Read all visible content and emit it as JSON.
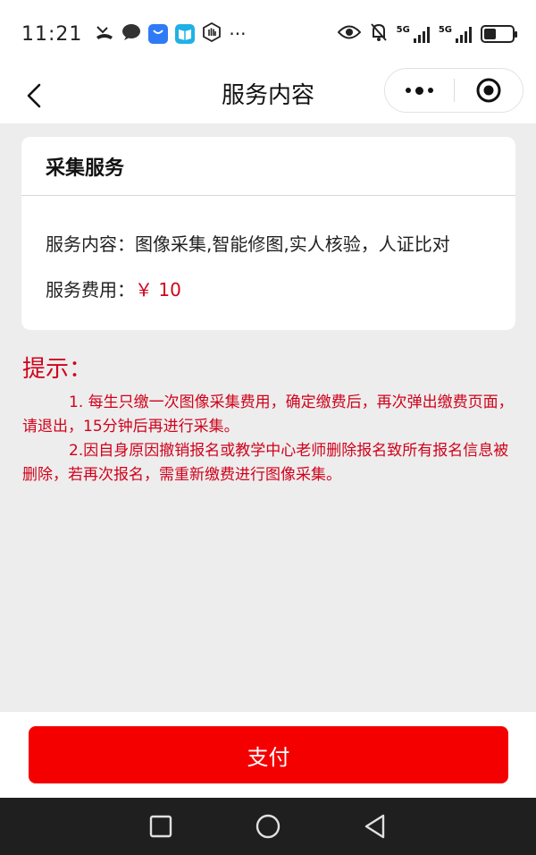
{
  "status_bar": {
    "time": "11:21",
    "more_dots": "···",
    "network_1": "5G",
    "network_2": "5G",
    "battery_level": 0.45
  },
  "nav": {
    "title": "服务内容"
  },
  "card": {
    "title": "采集服务",
    "content_label": "服务内容：",
    "content_value": "图像采集,智能修图,实人核验，人证比对",
    "fee_label": "服务费用：",
    "fee_value": "￥ 10"
  },
  "tips": {
    "title": "提示：",
    "items": [
      "1. 每生只缴一次图像采集费用，确定缴费后，再次弹出缴费页面，请退出，15分钟后再进行采集。",
      "2.因自身原因撤销报名或教学中心老师删除报名致所有报名信息被删除，若再次报名，需重新缴费进行图像采集。"
    ]
  },
  "footer": {
    "pay_label": "支付"
  },
  "colors": {
    "accent_red": "#f50000",
    "tip_red": "#d0021b"
  }
}
